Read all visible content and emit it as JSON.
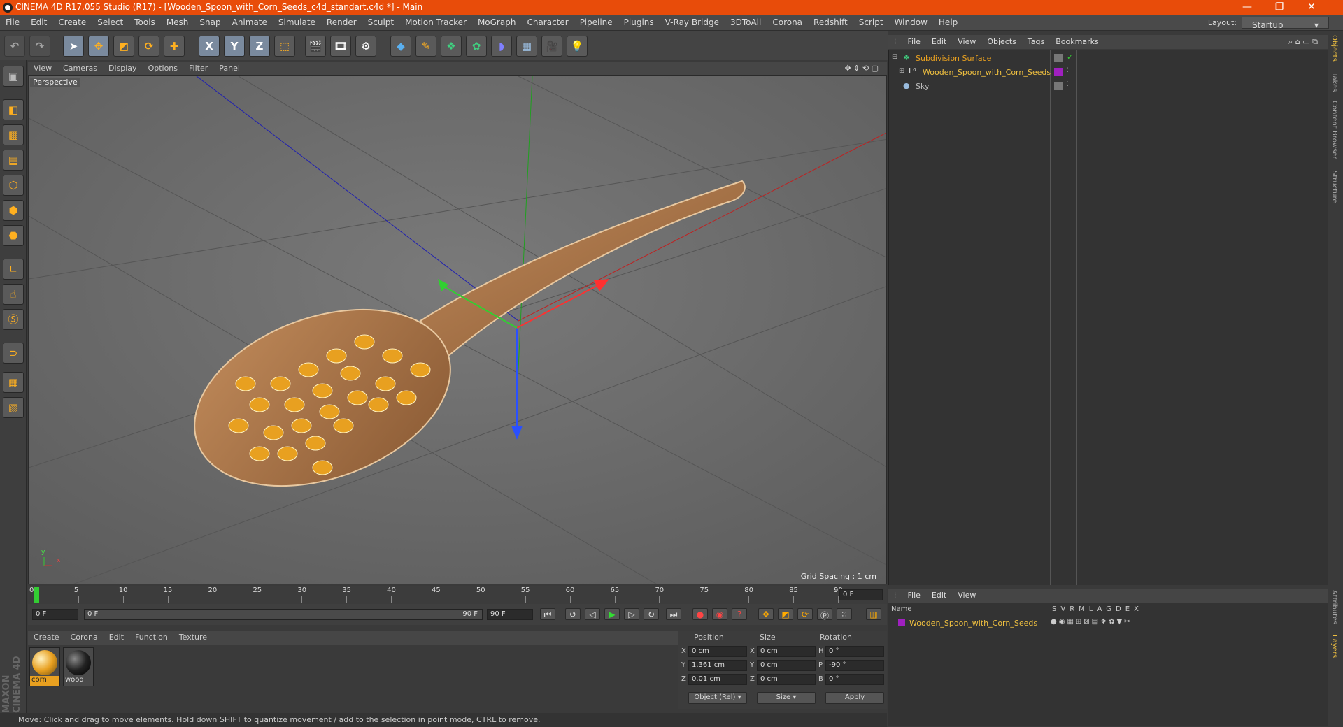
{
  "window": {
    "title": "CINEMA 4D R17.055 Studio (R17) - [Wooden_Spoon_with_Corn_Seeds_c4d_standart.c4d *] - Main",
    "controls": [
      "—",
      "❐",
      "✕"
    ]
  },
  "menubar": {
    "items": [
      "File",
      "Edit",
      "Create",
      "Select",
      "Tools",
      "Mesh",
      "Snap",
      "Animate",
      "Simulate",
      "Render",
      "Sculpt",
      "Motion Tracker",
      "MoGraph",
      "Character",
      "Pipeline",
      "Plugins",
      "V-Ray Bridge",
      "3DToAll",
      "Corona",
      "Redshift",
      "Script",
      "Window",
      "Help"
    ],
    "layout_label": "Layout:",
    "layout_value": "Startup"
  },
  "toolbar": {
    "axis_x": "X",
    "axis_y": "Y",
    "axis_z": "Z"
  },
  "viewport": {
    "menu": [
      "View",
      "Cameras",
      "Display",
      "Options",
      "Filter",
      "Panel"
    ],
    "camera_label": "Perspective",
    "grid_spacing": "Grid Spacing : 1 cm",
    "axis_x": "x",
    "axis_y": "y"
  },
  "timeline": {
    "ticks": [
      "0",
      "5",
      "10",
      "15",
      "20",
      "25",
      "30",
      "35",
      "40",
      "45",
      "50",
      "55",
      "60",
      "65",
      "70",
      "75",
      "80",
      "85",
      "90"
    ],
    "current_frame": "0 F",
    "start_field": "0 F",
    "range_start": "0 F",
    "range_end": "90 F",
    "end_field": "90 F"
  },
  "material_panel": {
    "menu": [
      "Create",
      "Corona",
      "Edit",
      "Function",
      "Texture"
    ],
    "materials": [
      {
        "name": "corn",
        "color": "#e8a020"
      },
      {
        "name": "wood",
        "color": "#222222"
      }
    ]
  },
  "coordinates": {
    "headers": [
      "Position",
      "Size",
      "Rotation"
    ],
    "rows": [
      {
        "axis": "X",
        "pos": "0 cm",
        "saxis": "X",
        "size": "0 cm",
        "raxis": "H",
        "rot": "0 °"
      },
      {
        "axis": "Y",
        "pos": "1.361 cm",
        "saxis": "Y",
        "size": "0 cm",
        "raxis": "P",
        "rot": "-90 °"
      },
      {
        "axis": "Z",
        "pos": "0.01 cm",
        "saxis": "Z",
        "size": "0 cm",
        "raxis": "B",
        "rot": "0 °"
      }
    ],
    "mode_select": "Object (Rel)",
    "size_select": "Size",
    "apply": "Apply"
  },
  "status": "Move: Click and drag to move elements. Hold down SHIFT to quantize movement / add to the selection in point mode, CTRL to remove.",
  "objects_panel": {
    "menu": [
      "File",
      "Edit",
      "View",
      "Objects",
      "Tags",
      "Bookmarks"
    ],
    "items": [
      {
        "name": "Subdivision Surface",
        "color": "#e8a020"
      },
      {
        "name": "Wooden_Spoon_with_Corn_Seeds",
        "color": "#f0c040"
      },
      {
        "name": "Sky",
        "color": "#bbbbbb"
      }
    ]
  },
  "layers_panel": {
    "menu": [
      "File",
      "Edit",
      "View"
    ],
    "columns": [
      "Name",
      "S",
      "V",
      "R",
      "M",
      "L",
      "A",
      "G",
      "D",
      "E",
      "X"
    ],
    "row": "Wooden_Spoon_with_Corn_Seeds"
  },
  "right_tabs": [
    "Objects",
    "Takes",
    "Content Browser",
    "Structure",
    "Attributes",
    "Layers"
  ],
  "branding": "MAXON CINEMA 4D"
}
